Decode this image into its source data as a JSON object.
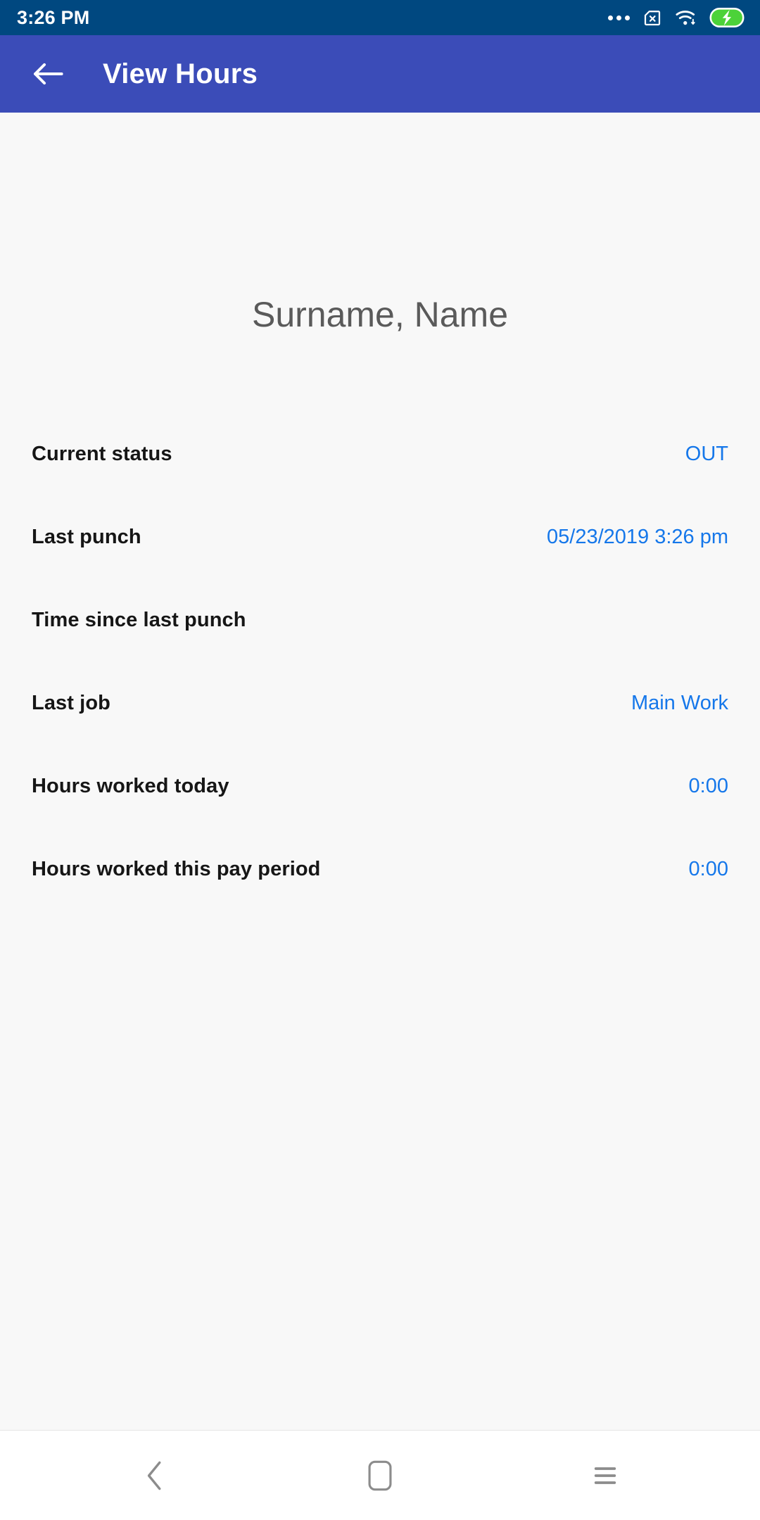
{
  "status_bar": {
    "clock": "3:26 PM",
    "icons": [
      "more-dots-icon",
      "no-sim-icon",
      "wifi-icon",
      "battery-charging-icon"
    ],
    "background_color": "#004880",
    "foreground_color": "#ffffff",
    "battery_fill_color": "#4cd239"
  },
  "app_bar": {
    "title": "View Hours",
    "back_icon": "arrow-left-icon",
    "background_color": "#3b4cb8",
    "text_color": "#ffffff"
  },
  "content": {
    "person_name": "Surname, Name",
    "background_color": "#f8f8f8",
    "label_color": "#161616",
    "value_color": "#1577ea",
    "rows": [
      {
        "label": "Current status",
        "value": "OUT"
      },
      {
        "label": "Last punch",
        "value": "05/23/2019 3:26 pm"
      },
      {
        "label": "Time since last punch",
        "value": ""
      },
      {
        "label": "Last job",
        "value": "Main Work"
      },
      {
        "label": "Hours worked today",
        "value": "0:00"
      },
      {
        "label": "Hours worked this pay period",
        "value": "0:00"
      }
    ]
  },
  "nav_bar": {
    "background_color": "#ffffff",
    "icon_color": "#8c8c8c",
    "buttons": [
      {
        "name": "back-nav-button",
        "icon": "chevron-left-icon"
      },
      {
        "name": "home-nav-button",
        "icon": "rounded-square-icon"
      },
      {
        "name": "recents-nav-button",
        "icon": "hamburger-icon"
      }
    ]
  }
}
